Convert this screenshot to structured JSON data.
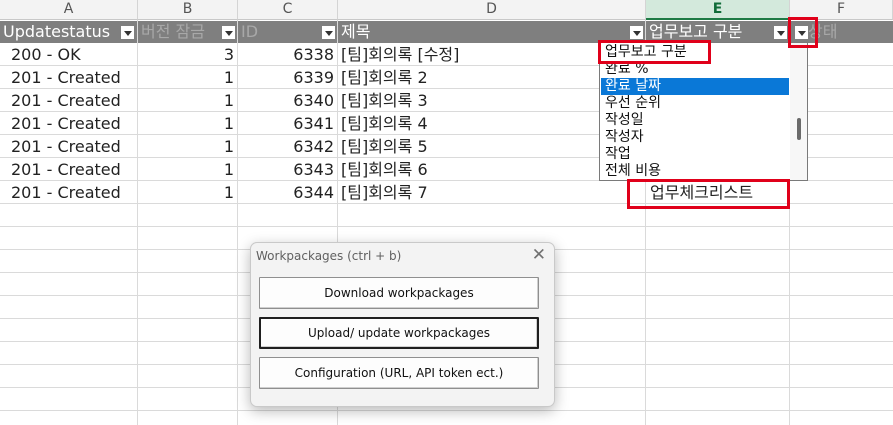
{
  "columns": [
    "A",
    "B",
    "C",
    "D",
    "E",
    "F"
  ],
  "header_row": {
    "a": "Updatestatus",
    "b": "버전 잠금",
    "c": "ID",
    "d": "제목",
    "e": "업무보고 구분",
    "f_partial": "상태"
  },
  "rows": [
    {
      "status": "200 - OK",
      "lock": "3",
      "id": "6338",
      "title": "[팀]회의록 [수정]"
    },
    {
      "status": "201 - Created",
      "lock": "1",
      "id": "6339",
      "title": "[팀]회의록 2"
    },
    {
      "status": "201 - Created",
      "lock": "1",
      "id": "6340",
      "title": "[팀]회의록 3"
    },
    {
      "status": "201 - Created",
      "lock": "1",
      "id": "6341",
      "title": "[팀]회의록 4"
    },
    {
      "status": "201 - Created",
      "lock": "1",
      "id": "6342",
      "title": "[팀]회의록 5"
    },
    {
      "status": "201 - Created",
      "lock": "1",
      "id": "6343",
      "title": "[팀]회의록 6"
    },
    {
      "status": "201 - Created",
      "lock": "1",
      "id": "6344",
      "title": "[팀]회의록 7"
    }
  ],
  "dropdown": {
    "items": [
      "업무보고 구분",
      "완료 %",
      "완료 날짜",
      "우선 순위",
      "작성일",
      "작성자",
      "작업",
      "전체 비용"
    ],
    "highlighted": "완료 날짜",
    "highlight_color": "#0a78d7"
  },
  "cell_e8_value": "업무체크리스트",
  "dialog": {
    "title": "Workpackages (ctrl + b)",
    "close": "✕",
    "buttons": [
      "Download workpackages",
      "Upload/ update workpackages",
      "Configuration (URL, API token ect.)"
    ]
  },
  "colors": {
    "header_bg": "#7f7f7f",
    "selected_column": "#d3e9dc",
    "annotation_red": "#e0001a"
  },
  "icons": [
    "filter-dropdown-arrow-icon",
    "close-icon"
  ]
}
